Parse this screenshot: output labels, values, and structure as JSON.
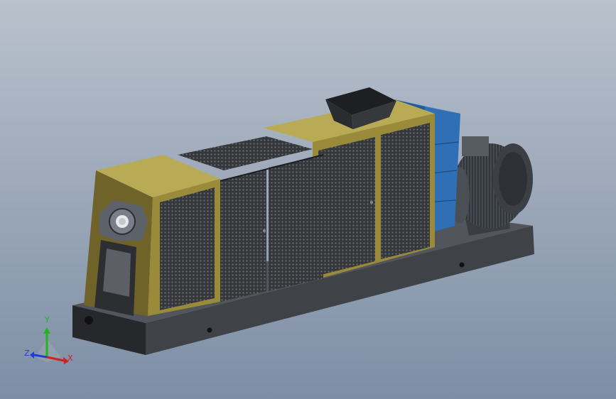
{
  "viewport": {
    "background_top": "#b9c1cc",
    "background_bottom": "#7d8ea5"
  },
  "colors": {
    "housing_olive": "#9a8b3a",
    "housing_olive_light": "#b9ab55",
    "housing_olive_dark": "#6f632a",
    "mesh_panel": "#3a3c40",
    "base_dark": "#2d2f33",
    "base_side": "#3f4247",
    "motor_grey": "#4b4f56",
    "gearbox_blue": "#2f6fb6",
    "gearbox_blue_light": "#4f8fd3",
    "hopper": "#2a2b2e"
  },
  "triad": {
    "x_label": "X",
    "y_label": "Y",
    "z_label": "Z",
    "x_color": "#d21f1f",
    "y_color": "#1fb51f",
    "z_color": "#1f3fd2"
  }
}
